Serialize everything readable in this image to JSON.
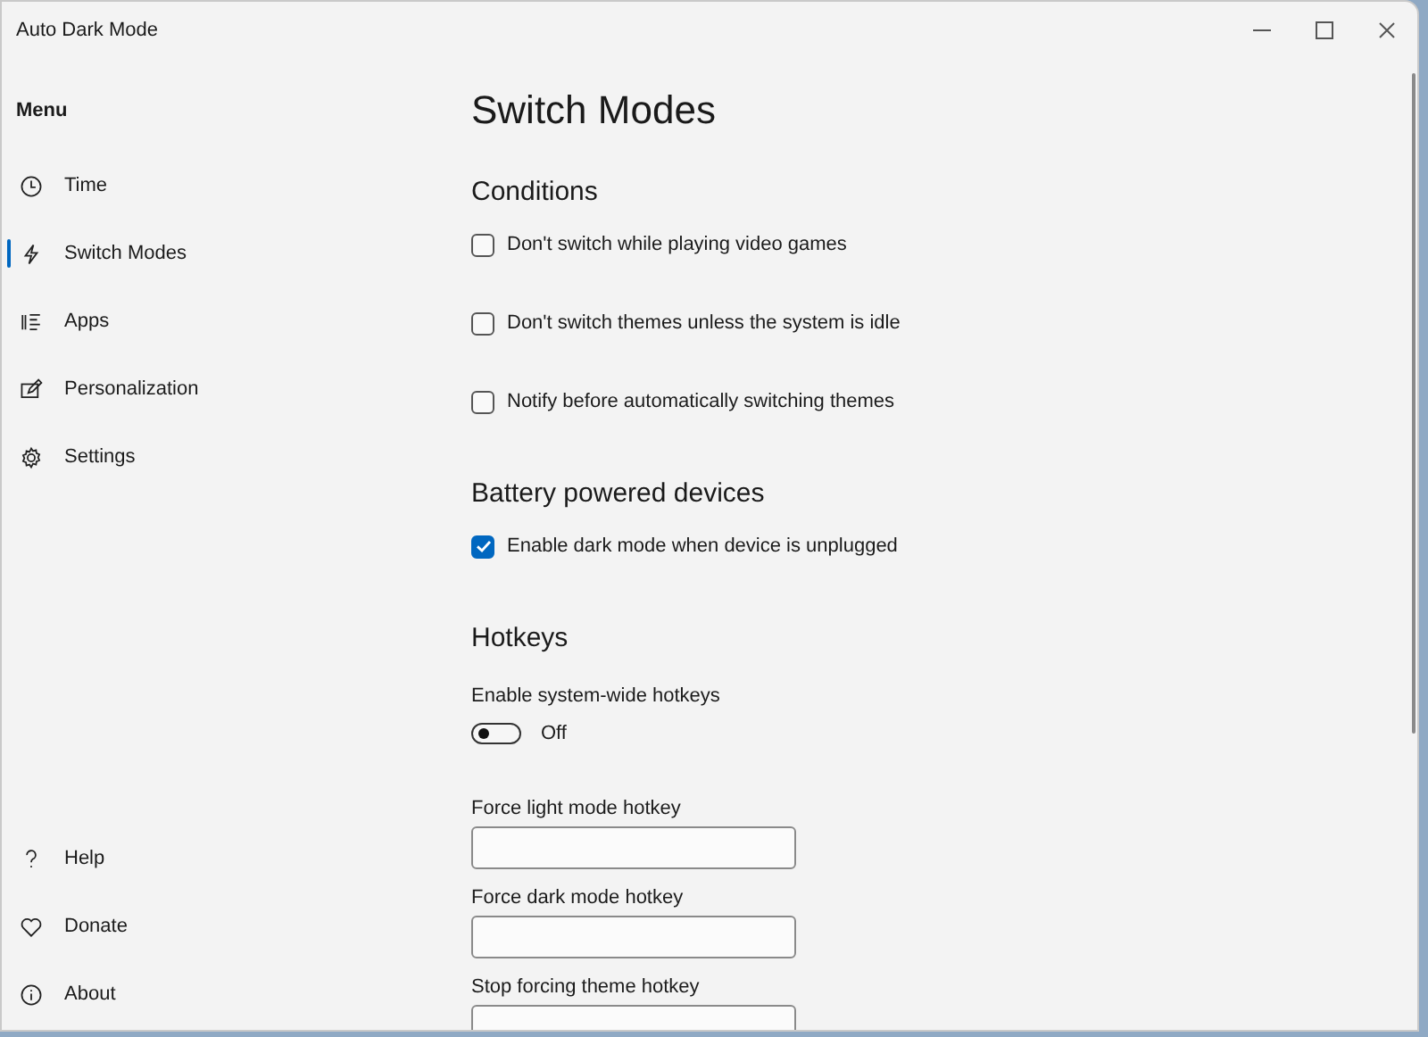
{
  "window": {
    "title": "Auto Dark Mode"
  },
  "sidebar": {
    "heading": "Menu",
    "items": [
      {
        "label": "Time",
        "selected": false
      },
      {
        "label": "Switch Modes",
        "selected": true
      },
      {
        "label": "Apps",
        "selected": false
      },
      {
        "label": "Personalization",
        "selected": false
      },
      {
        "label": "Settings",
        "selected": false
      }
    ],
    "footer_items": [
      {
        "label": "Help",
        "selected": false
      },
      {
        "label": "Donate",
        "selected": false
      },
      {
        "label": "About",
        "selected": false
      }
    ]
  },
  "page": {
    "title": "Switch Modes",
    "sections": [
      {
        "heading": "Conditions",
        "controls": [
          {
            "kind": "checkbox",
            "label": "Don't switch while playing video games",
            "checked": false
          },
          {
            "kind": "checkbox",
            "label": "Don't switch themes unless the system is idle",
            "checked": false
          },
          {
            "kind": "checkbox",
            "label": "Notify before automatically switching themes",
            "checked": false
          }
        ]
      },
      {
        "heading": "Battery powered devices",
        "controls": [
          {
            "kind": "checkbox",
            "label": "Enable dark mode when device is unplugged",
            "checked": true
          }
        ]
      },
      {
        "heading": "Hotkeys",
        "controls": [
          {
            "kind": "toggle",
            "label": "Enable system-wide hotkeys",
            "on": false,
            "state_text": "Off"
          },
          {
            "kind": "hotkey",
            "label": "Force light mode hotkey"
          },
          {
            "kind": "hotkey",
            "label": "Force dark mode hotkey"
          },
          {
            "kind": "hotkey",
            "label": "Stop forcing theme hotkey"
          }
        ]
      }
    ]
  }
}
